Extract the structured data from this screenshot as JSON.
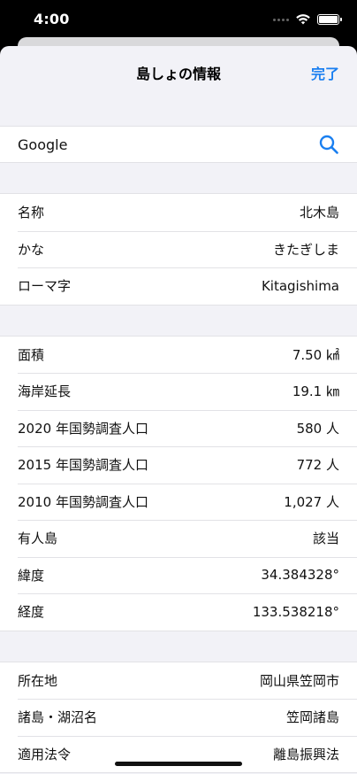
{
  "status_bar": {
    "time": "4:00"
  },
  "nav": {
    "title": "島しょの情報",
    "done_label": "完了"
  },
  "search": {
    "label": "Google",
    "icon": "search-icon"
  },
  "name_section": [
    {
      "label": "名称",
      "value": "北木島"
    },
    {
      "label": "かな",
      "value": "きたぎしま"
    },
    {
      "label": "ローマ字",
      "value": "Kitagishima"
    }
  ],
  "stats_section": [
    {
      "label": "面積",
      "value": "7.50 ㎢"
    },
    {
      "label": "海岸延長",
      "value": "19.1 ㎞"
    },
    {
      "label": "2020 年国勢調査人口",
      "value": "580 人"
    },
    {
      "label": "2015 年国勢調査人口",
      "value": "772 人"
    },
    {
      "label": "2010 年国勢調査人口",
      "value": "1,027 人"
    },
    {
      "label": "有人島",
      "value": "該当"
    },
    {
      "label": "緯度",
      "value": "34.384328°"
    },
    {
      "label": "経度",
      "value": "133.538218°"
    }
  ],
  "location_section": [
    {
      "label": "所在地",
      "value": "岡山県笠岡市"
    },
    {
      "label": "諸島・湖沼名",
      "value": "笠岡諸島"
    },
    {
      "label": "適用法令",
      "value": "離島振興法"
    }
  ],
  "colors": {
    "accent": "#1a7ff0",
    "background": "#f2f2f7"
  }
}
